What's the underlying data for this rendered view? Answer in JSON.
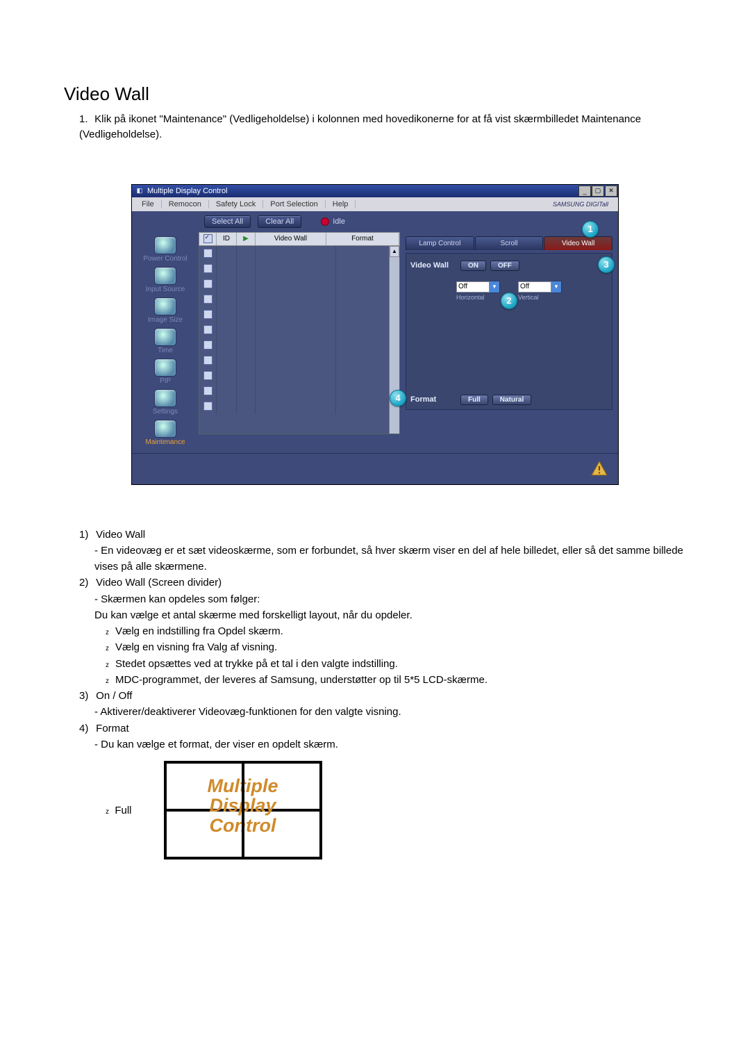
{
  "title": "Video Wall",
  "intro_num": "1.",
  "intro": "Klik på ikonet \"Maintenance\" (Vedligeholdelse) i kolonnen med hovedikonerne for at få vist skærmbilledet Maintenance (Vedligeholdelse).",
  "app": {
    "title": "Multiple Display Control",
    "menu": [
      "File",
      "Remocon",
      "Safety Lock",
      "Port Selection",
      "Help"
    ],
    "brand": "SAMSUNG DIGITall",
    "select_all": "Select All",
    "clear_all": "Clear All",
    "idle": "Idle",
    "sidebar": [
      {
        "label": "Power Control"
      },
      {
        "label": "Input Source"
      },
      {
        "label": "Image Size"
      },
      {
        "label": "Time"
      },
      {
        "label": "PIP"
      },
      {
        "label": "Settings"
      },
      {
        "label": "Maintenance",
        "selected": true
      }
    ],
    "columns": {
      "id": "ID",
      "vw": "Video Wall",
      "fmt": "Format"
    },
    "row_checked": true,
    "tabs": [
      "Lamp Control",
      "Scroll",
      "Video Wall"
    ],
    "panel": {
      "vw_label": "Video Wall",
      "on": "ON",
      "off": "OFF",
      "h_val": "Off",
      "v_val": "Off",
      "h_axis": "Horizontal",
      "v_axis": "Vertical",
      "fmt_label": "Format",
      "full": "Full",
      "natural": "Natural"
    }
  },
  "sections": [
    {
      "num": "1)",
      "title": "Video Wall",
      "lines": [
        "- En videovæg er et sæt videoskærme, som er forbundet, så hver skærm viser en del af hele billedet, eller så det samme billede vises på alle skærmene."
      ]
    },
    {
      "num": "2)",
      "title": "Video Wall (Screen divider)",
      "lines": [
        "- Skærmen kan opdeles som følger:",
        "Du kan vælge et antal skærme med forskelligt layout, når du opdeler."
      ],
      "bullets": [
        "Vælg en indstilling fra Opdel skærm.",
        "Vælg en visning fra Valg af visning.",
        "Stedet opsættes ved at trykke på et tal i den valgte indstilling.",
        "MDC-programmet, der leveres af Samsung, understøtter op til 5*5 LCD-skærme."
      ]
    },
    {
      "num": "3)",
      "title": "On / Off",
      "lines": [
        "- Aktiverer/deaktiverer Videovæg-funktionen for den valgte visning."
      ]
    },
    {
      "num": "4)",
      "title": "Format",
      "lines": [
        "- Du kan vælge et format, der viser en opdelt skærm."
      ]
    }
  ],
  "format_example": {
    "label": "Full",
    "l1": "Multiple",
    "l2": "Display",
    "l3": "Control"
  }
}
